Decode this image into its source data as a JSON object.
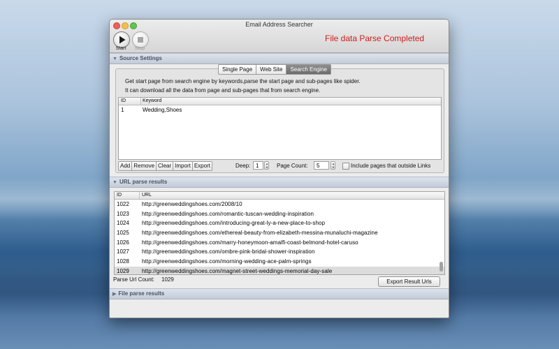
{
  "window": {
    "title": "Email Address Searcher"
  },
  "toolbar": {
    "start_label": "Start",
    "stop_label": "Stop",
    "status": "File data Parse Completed"
  },
  "source_settings": {
    "header": "Source Settings",
    "tabs": [
      "Single Page",
      "Web Site",
      "Search Engine"
    ],
    "active_tab": "Search Engine",
    "description": [
      "Get start page from search engine by keywords,parse the start page and sub-pages like spider.",
      "It can download all the data from page and sub-pages that from search engine."
    ],
    "keyword_table": {
      "columns": [
        "ID",
        "Keyword"
      ],
      "rows": [
        {
          "id": "1",
          "keyword": "Wedding,Shoes"
        }
      ]
    },
    "buttons": [
      "Add",
      "Remove",
      "Clear",
      "Import",
      "Export"
    ],
    "deep": {
      "label": "Deep:",
      "value": "1"
    },
    "page_count": {
      "label": "Page Count:",
      "value": "5"
    },
    "include_outside": {
      "label": "Include pages that outside Links",
      "checked": false
    }
  },
  "url_results": {
    "header": "URL parse results",
    "columns": [
      "ID",
      "URL"
    ],
    "rows": [
      {
        "id": "1022",
        "url": "http://greenweddingshoes.com/2008/10"
      },
      {
        "id": "1023",
        "url": "http://greenweddingshoes.com/romantic-tuscan-wedding-inspiration"
      },
      {
        "id": "1024",
        "url": "http://greenweddingshoes.com/introducing-great-ly-a-new-place-to-shop"
      },
      {
        "id": "1025",
        "url": "http://greenweddingshoes.com/ethereal-beauty-from-elizabeth-messina-munaluchi-magazine"
      },
      {
        "id": "1026",
        "url": "http://greenweddingshoes.com/marry-honeymoon-amalfi-coast-belmond-hotel-caruso"
      },
      {
        "id": "1027",
        "url": "http://greenweddingshoes.com/ombre-pink-bridal-shower-inspiration"
      },
      {
        "id": "1028",
        "url": "http://greenweddingshoes.com/morning-wedding-ace-palm-springs"
      },
      {
        "id": "1029",
        "url": "http://greenweddingshoes.com/magnet-street-weddings-memorial-day-sale"
      }
    ],
    "count_label": "Parse Url Count:",
    "count_value": "1029",
    "export_label": "Export Result Urls"
  },
  "file_results": {
    "header": "File parse results"
  },
  "colors": {
    "status": "#d01c1c",
    "accent_header": "#c3ccd9"
  }
}
